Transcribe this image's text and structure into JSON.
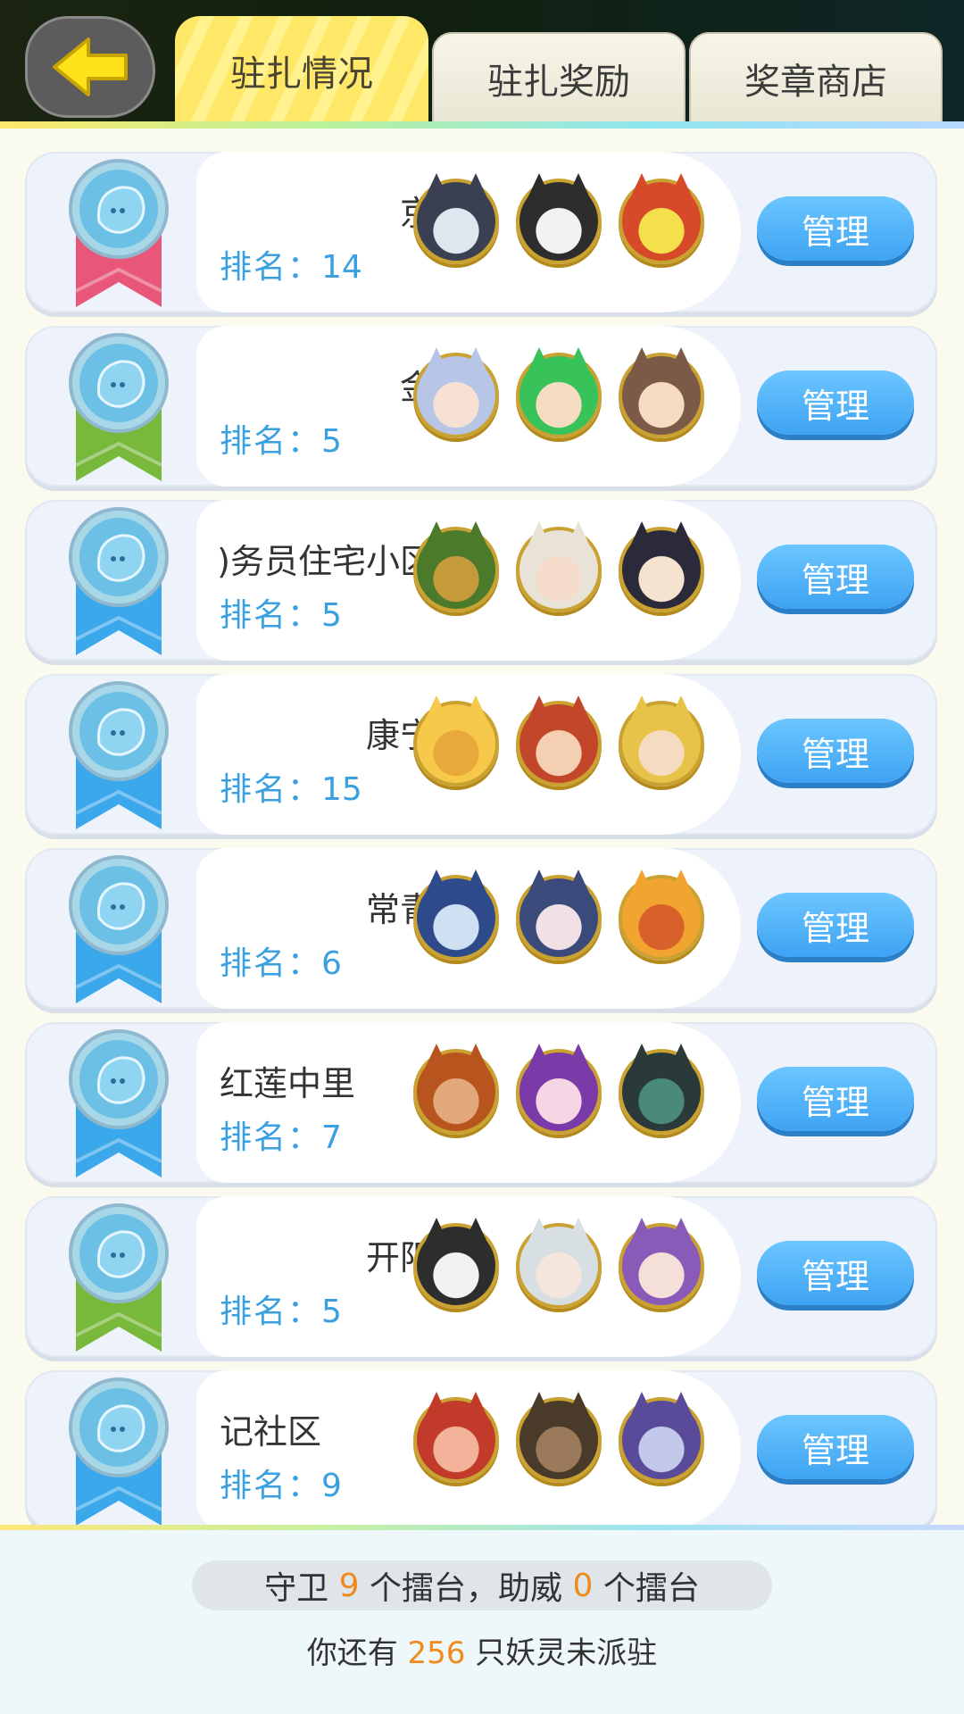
{
  "tabs": [
    {
      "label": "驻扎情况",
      "active": true
    },
    {
      "label": "驻扎奖励",
      "active": false
    },
    {
      "label": "奖章商店",
      "active": false
    }
  ],
  "colors": {
    "medal_red": "#e8567a",
    "medal_green": "#78b93c",
    "medal_blue": "#3aa8ea",
    "rank_text": "#3aa0e0",
    "manage_button": "#4aaef5",
    "highlight_number": "#f08a1c"
  },
  "stations": [
    {
      "name": "京",
      "rank_label": "排名：",
      "rank": "14",
      "ribbon": "red",
      "name_align": "right",
      "avatars": [
        "silver-horned-hero",
        "panda-monk",
        "crystal-creature"
      ]
    },
    {
      "name": "金",
      "rank_label": "排名：",
      "rank": "5",
      "ribbon": "green",
      "name_align": "right",
      "avatars": [
        "fox-girl",
        "green-hair-boy",
        "horned-girl"
      ]
    },
    {
      "name": "务员住宅小区(",
      "rank_label": "排名：",
      "rank": "5",
      "ribbon": "blue",
      "name_align": "right",
      "avatars": [
        "armored-beast",
        "oni-girl",
        "antler-girl"
      ]
    },
    {
      "name": "康宁",
      "rank_label": "排名：",
      "rank": "15",
      "ribbon": "blue",
      "name_align": "right",
      "avatars": [
        "lion-king",
        "fire-warrior",
        "golden-hair-boy"
      ]
    },
    {
      "name": "常青",
      "rank_label": "排名：",
      "rank": "6",
      "ribbon": "blue",
      "name_align": "right",
      "avatars": [
        "blue-hair-sage",
        "blue-bow-boy",
        "flame-demon"
      ]
    },
    {
      "name": "红莲中里",
      "rank_label": "排名：",
      "rank": "7",
      "ribbon": "blue",
      "name_align": "left",
      "avatars": [
        "lion-man",
        "purple-cat-girl",
        "dragon-knight"
      ]
    },
    {
      "name": "开阳",
      "rank_label": "排名：",
      "rank": "5",
      "ribbon": "green",
      "name_align": "right",
      "avatars": [
        "panda-monk",
        "silver-hair-girl",
        "purple-priestess"
      ]
    },
    {
      "name": "记社区",
      "rank_label": "排名：",
      "rank": "9",
      "ribbon": "blue",
      "name_align": "left",
      "avatars": [
        "pig-warrior",
        "masked-beast",
        "purple-dragon"
      ]
    }
  ],
  "manage_label": "管理",
  "summary": {
    "guard_prefix": "守卫",
    "guard_count": "9",
    "guard_unit": "个擂台，助威",
    "cheer_count": "0",
    "cheer_unit": "个擂台",
    "remaining_prefix": "你还有",
    "remaining_count": "256",
    "remaining_suffix": "只妖灵未派驻"
  }
}
